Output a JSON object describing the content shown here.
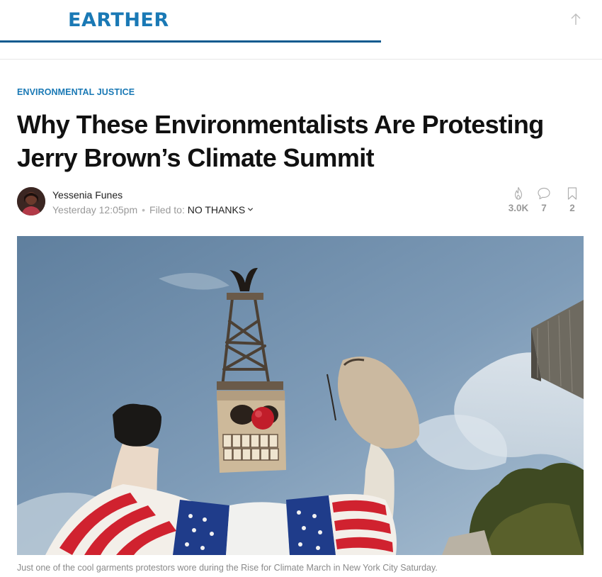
{
  "site": {
    "logo": "EARTHER"
  },
  "article": {
    "category": "ENVIRONMENTAL JUSTICE",
    "headline": "Why These Environmentalists Are Protesting Jerry Brown’s Climate Summit",
    "author": "Yessenia Funes",
    "timestamp": "Yesterday 12:05pm",
    "filed_label": "Filed to:",
    "filed_value": "NO THANKS",
    "caption": "Just one of the cool garments protestors wore during the Rise for Climate March in New York City Saturday."
  },
  "stats": {
    "kinja": "3.0K",
    "comments": "7",
    "bookmarks": "2"
  },
  "icons": {
    "scroll_top": "arrow-up-icon",
    "kinja": "flame-icon",
    "comments": "speech-bubble-icon",
    "bookmarks": "bookmark-icon",
    "filed_dropdown": "chevron-down-icon"
  },
  "colors": {
    "brand": "#1a79b5",
    "brand_dark": "#0c5a8f",
    "meta": "#999999",
    "text": "#111111"
  }
}
